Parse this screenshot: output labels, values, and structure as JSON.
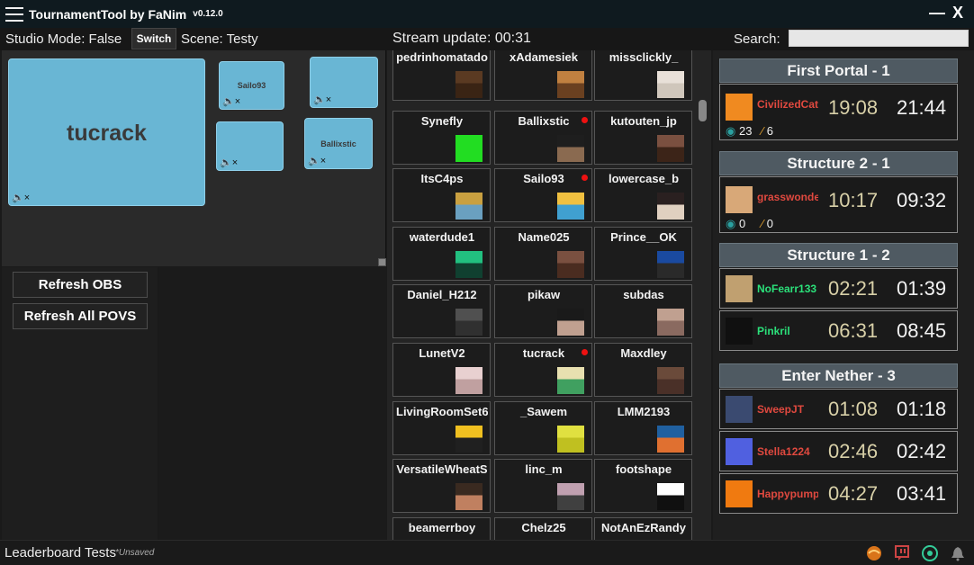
{
  "app": {
    "title": "TournamentTool by FaNim",
    "version": "v0.12.0",
    "minimize": "—",
    "close": "X"
  },
  "studio": {
    "mode_label": "Studio Mode: False",
    "switch_label": "Switch",
    "scene_label": "Scene: Testy",
    "search_label": "Search:",
    "search_value": ""
  },
  "stream_update": "Stream update: 00:31",
  "preview": {
    "main": "tucrack",
    "small": [
      "Sailo93",
      "",
      "",
      "Ballixstic"
    ]
  },
  "buttons": {
    "refresh_obs": "Refresh OBS",
    "refresh_all_povs": "Refresh All POVS"
  },
  "players": [
    {
      "name": "pedrinhomatado"
    },
    {
      "name": "xAdamesiek"
    },
    {
      "name": "missclickly_"
    },
    {
      "name": "Synefly"
    },
    {
      "name": "Ballixstic",
      "live": true
    },
    {
      "name": "kutouten_jp"
    },
    {
      "name": "ItsC4ps"
    },
    {
      "name": "Sailo93",
      "live": true
    },
    {
      "name": "lowercase_b"
    },
    {
      "name": "waterdude1"
    },
    {
      "name": "Name025"
    },
    {
      "name": "Prince__OK"
    },
    {
      "name": "Daniel_H212"
    },
    {
      "name": "pikaw"
    },
    {
      "name": "subdas"
    },
    {
      "name": "LunetV2"
    },
    {
      "name": "tucrack",
      "live": true
    },
    {
      "name": "Maxdley"
    },
    {
      "name": "LivingRoomSet6"
    },
    {
      "name": "_Sawem"
    },
    {
      "name": "LMM2193"
    },
    {
      "name": "VersatileWheatS"
    },
    {
      "name": "linc_m"
    },
    {
      "name": "footshape"
    },
    {
      "name": "beamerrboy"
    },
    {
      "name": "Chelz25"
    },
    {
      "name": "NotAnEzRandy"
    }
  ],
  "leaderboard": {
    "groups": [
      {
        "title": "First Portal - 1",
        "rows": [
          {
            "name": "CivilizedCat",
            "t1": "19:08",
            "t2": "21:44",
            "pearls": "23",
            "rods": "6",
            "color": "#e0493f"
          }
        ]
      },
      {
        "title": "Structure 2 - 1",
        "rows": [
          {
            "name": "grasswonder",
            "t1": "10:17",
            "t2": "09:32",
            "pearls": "0",
            "rods": "0",
            "color": "#e0493f"
          }
        ]
      },
      {
        "title": "Structure 1 - 2",
        "rows": [
          {
            "name": "NoFearr133",
            "t1": "02:21",
            "t2": "01:39",
            "color": "#2be07a"
          },
          {
            "name": "Pinkril",
            "t1": "06:31",
            "t2": "08:45",
            "color": "#2be07a"
          }
        ]
      },
      {
        "title": "Enter Nether - 3",
        "rows": [
          {
            "name": "SweepJT",
            "t1": "01:08",
            "t2": "01:18",
            "color": "#e0493f"
          },
          {
            "name": "Stella1224",
            "t1": "02:46",
            "t2": "02:42",
            "color": "#e0493f"
          },
          {
            "name": "Happypumpkin",
            "t1": "04:27",
            "t2": "03:41",
            "color": "#e0493f"
          }
        ]
      }
    ]
  },
  "status": {
    "name": "Leaderboard Tests",
    "unsaved": "*Unsaved"
  }
}
